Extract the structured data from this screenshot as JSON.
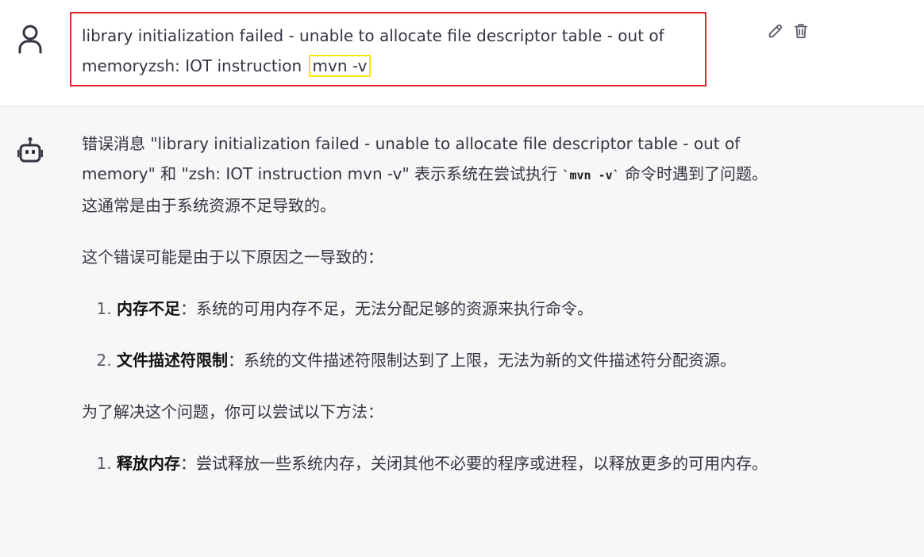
{
  "user_message": {
    "text": "library initialization failed - unable to allocate file descriptor table - out of memoryzsh: IOT instruction",
    "highlight": "mvn -v"
  },
  "bot_message": {
    "intro_1": "错误消息 \"library initialization failed - unable to allocate file descriptor table - out of memory\" 和 \"zsh: IOT instruction mvn -v\" 表示系统在尝试执行 ",
    "intro_code": "`mvn -v`",
    "intro_2": " 命令时遇到了问题。这通常是由于系统资源不足导致的。",
    "causes_heading": "这个错误可能是由于以下原因之一导致的：",
    "causes": [
      {
        "title": "内存不足",
        "text": "：系统的可用内存不足，无法分配足够的资源来执行命令。"
      },
      {
        "title": "文件描述符限制",
        "text": "：系统的文件描述符限制达到了上限，无法为新的文件描述符分配资源。"
      }
    ],
    "solutions_heading": "为了解决这个问题，你可以尝试以下方法：",
    "solutions": [
      {
        "title": "释放内存",
        "text": "：尝试释放一些系统内存，关闭其他不必要的程序或进程，以释放更多的可用内存。"
      }
    ]
  },
  "icons": {
    "user_avatar": "user-icon",
    "bot_avatar": "robot-icon",
    "edit": "pencil-icon",
    "delete": "trash-icon"
  },
  "colors": {
    "annotation_red": "#e0262b",
    "annotation_yellow": "#f5e80a",
    "bot_background": "#f7f7f8"
  }
}
